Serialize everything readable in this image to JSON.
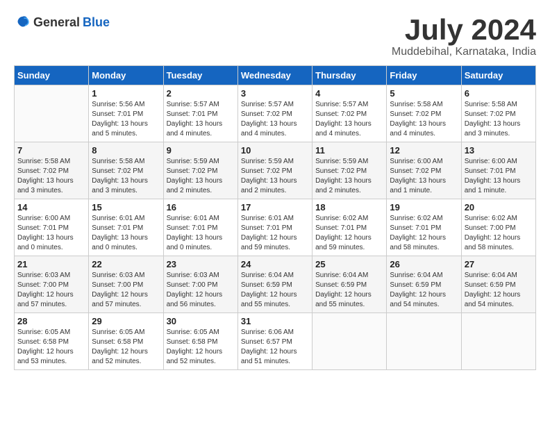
{
  "header": {
    "logo_general": "General",
    "logo_blue": "Blue",
    "title": "July 2024",
    "subtitle": "Muddebihal, Karnataka, India"
  },
  "calendar": {
    "days": [
      "Sunday",
      "Monday",
      "Tuesday",
      "Wednesday",
      "Thursday",
      "Friday",
      "Saturday"
    ],
    "weeks": [
      [
        {
          "date": "",
          "info": ""
        },
        {
          "date": "1",
          "info": "Sunrise: 5:56 AM\nSunset: 7:01 PM\nDaylight: 13 hours\nand 5 minutes."
        },
        {
          "date": "2",
          "info": "Sunrise: 5:57 AM\nSunset: 7:01 PM\nDaylight: 13 hours\nand 4 minutes."
        },
        {
          "date": "3",
          "info": "Sunrise: 5:57 AM\nSunset: 7:02 PM\nDaylight: 13 hours\nand 4 minutes."
        },
        {
          "date": "4",
          "info": "Sunrise: 5:57 AM\nSunset: 7:02 PM\nDaylight: 13 hours\nand 4 minutes."
        },
        {
          "date": "5",
          "info": "Sunrise: 5:58 AM\nSunset: 7:02 PM\nDaylight: 13 hours\nand 4 minutes."
        },
        {
          "date": "6",
          "info": "Sunrise: 5:58 AM\nSunset: 7:02 PM\nDaylight: 13 hours\nand 3 minutes."
        }
      ],
      [
        {
          "date": "7",
          "info": "Sunrise: 5:58 AM\nSunset: 7:02 PM\nDaylight: 13 hours\nand 3 minutes."
        },
        {
          "date": "8",
          "info": "Sunrise: 5:58 AM\nSunset: 7:02 PM\nDaylight: 13 hours\nand 3 minutes."
        },
        {
          "date": "9",
          "info": "Sunrise: 5:59 AM\nSunset: 7:02 PM\nDaylight: 13 hours\nand 2 minutes."
        },
        {
          "date": "10",
          "info": "Sunrise: 5:59 AM\nSunset: 7:02 PM\nDaylight: 13 hours\nand 2 minutes."
        },
        {
          "date": "11",
          "info": "Sunrise: 5:59 AM\nSunset: 7:02 PM\nDaylight: 13 hours\nand 2 minutes."
        },
        {
          "date": "12",
          "info": "Sunrise: 6:00 AM\nSunset: 7:02 PM\nDaylight: 13 hours\nand 1 minute."
        },
        {
          "date": "13",
          "info": "Sunrise: 6:00 AM\nSunset: 7:01 PM\nDaylight: 13 hours\nand 1 minute."
        }
      ],
      [
        {
          "date": "14",
          "info": "Sunrise: 6:00 AM\nSunset: 7:01 PM\nDaylight: 13 hours\nand 0 minutes."
        },
        {
          "date": "15",
          "info": "Sunrise: 6:01 AM\nSunset: 7:01 PM\nDaylight: 13 hours\nand 0 minutes."
        },
        {
          "date": "16",
          "info": "Sunrise: 6:01 AM\nSunset: 7:01 PM\nDaylight: 13 hours\nand 0 minutes."
        },
        {
          "date": "17",
          "info": "Sunrise: 6:01 AM\nSunset: 7:01 PM\nDaylight: 12 hours\nand 59 minutes."
        },
        {
          "date": "18",
          "info": "Sunrise: 6:02 AM\nSunset: 7:01 PM\nDaylight: 12 hours\nand 59 minutes."
        },
        {
          "date": "19",
          "info": "Sunrise: 6:02 AM\nSunset: 7:01 PM\nDaylight: 12 hours\nand 58 minutes."
        },
        {
          "date": "20",
          "info": "Sunrise: 6:02 AM\nSunset: 7:00 PM\nDaylight: 12 hours\nand 58 minutes."
        }
      ],
      [
        {
          "date": "21",
          "info": "Sunrise: 6:03 AM\nSunset: 7:00 PM\nDaylight: 12 hours\nand 57 minutes."
        },
        {
          "date": "22",
          "info": "Sunrise: 6:03 AM\nSunset: 7:00 PM\nDaylight: 12 hours\nand 57 minutes."
        },
        {
          "date": "23",
          "info": "Sunrise: 6:03 AM\nSunset: 7:00 PM\nDaylight: 12 hours\nand 56 minutes."
        },
        {
          "date": "24",
          "info": "Sunrise: 6:04 AM\nSunset: 6:59 PM\nDaylight: 12 hours\nand 55 minutes."
        },
        {
          "date": "25",
          "info": "Sunrise: 6:04 AM\nSunset: 6:59 PM\nDaylight: 12 hours\nand 55 minutes."
        },
        {
          "date": "26",
          "info": "Sunrise: 6:04 AM\nSunset: 6:59 PM\nDaylight: 12 hours\nand 54 minutes."
        },
        {
          "date": "27",
          "info": "Sunrise: 6:04 AM\nSunset: 6:59 PM\nDaylight: 12 hours\nand 54 minutes."
        }
      ],
      [
        {
          "date": "28",
          "info": "Sunrise: 6:05 AM\nSunset: 6:58 PM\nDaylight: 12 hours\nand 53 minutes."
        },
        {
          "date": "29",
          "info": "Sunrise: 6:05 AM\nSunset: 6:58 PM\nDaylight: 12 hours\nand 52 minutes."
        },
        {
          "date": "30",
          "info": "Sunrise: 6:05 AM\nSunset: 6:58 PM\nDaylight: 12 hours\nand 52 minutes."
        },
        {
          "date": "31",
          "info": "Sunrise: 6:06 AM\nSunset: 6:57 PM\nDaylight: 12 hours\nand 51 minutes."
        },
        {
          "date": "",
          "info": ""
        },
        {
          "date": "",
          "info": ""
        },
        {
          "date": "",
          "info": ""
        }
      ]
    ]
  }
}
